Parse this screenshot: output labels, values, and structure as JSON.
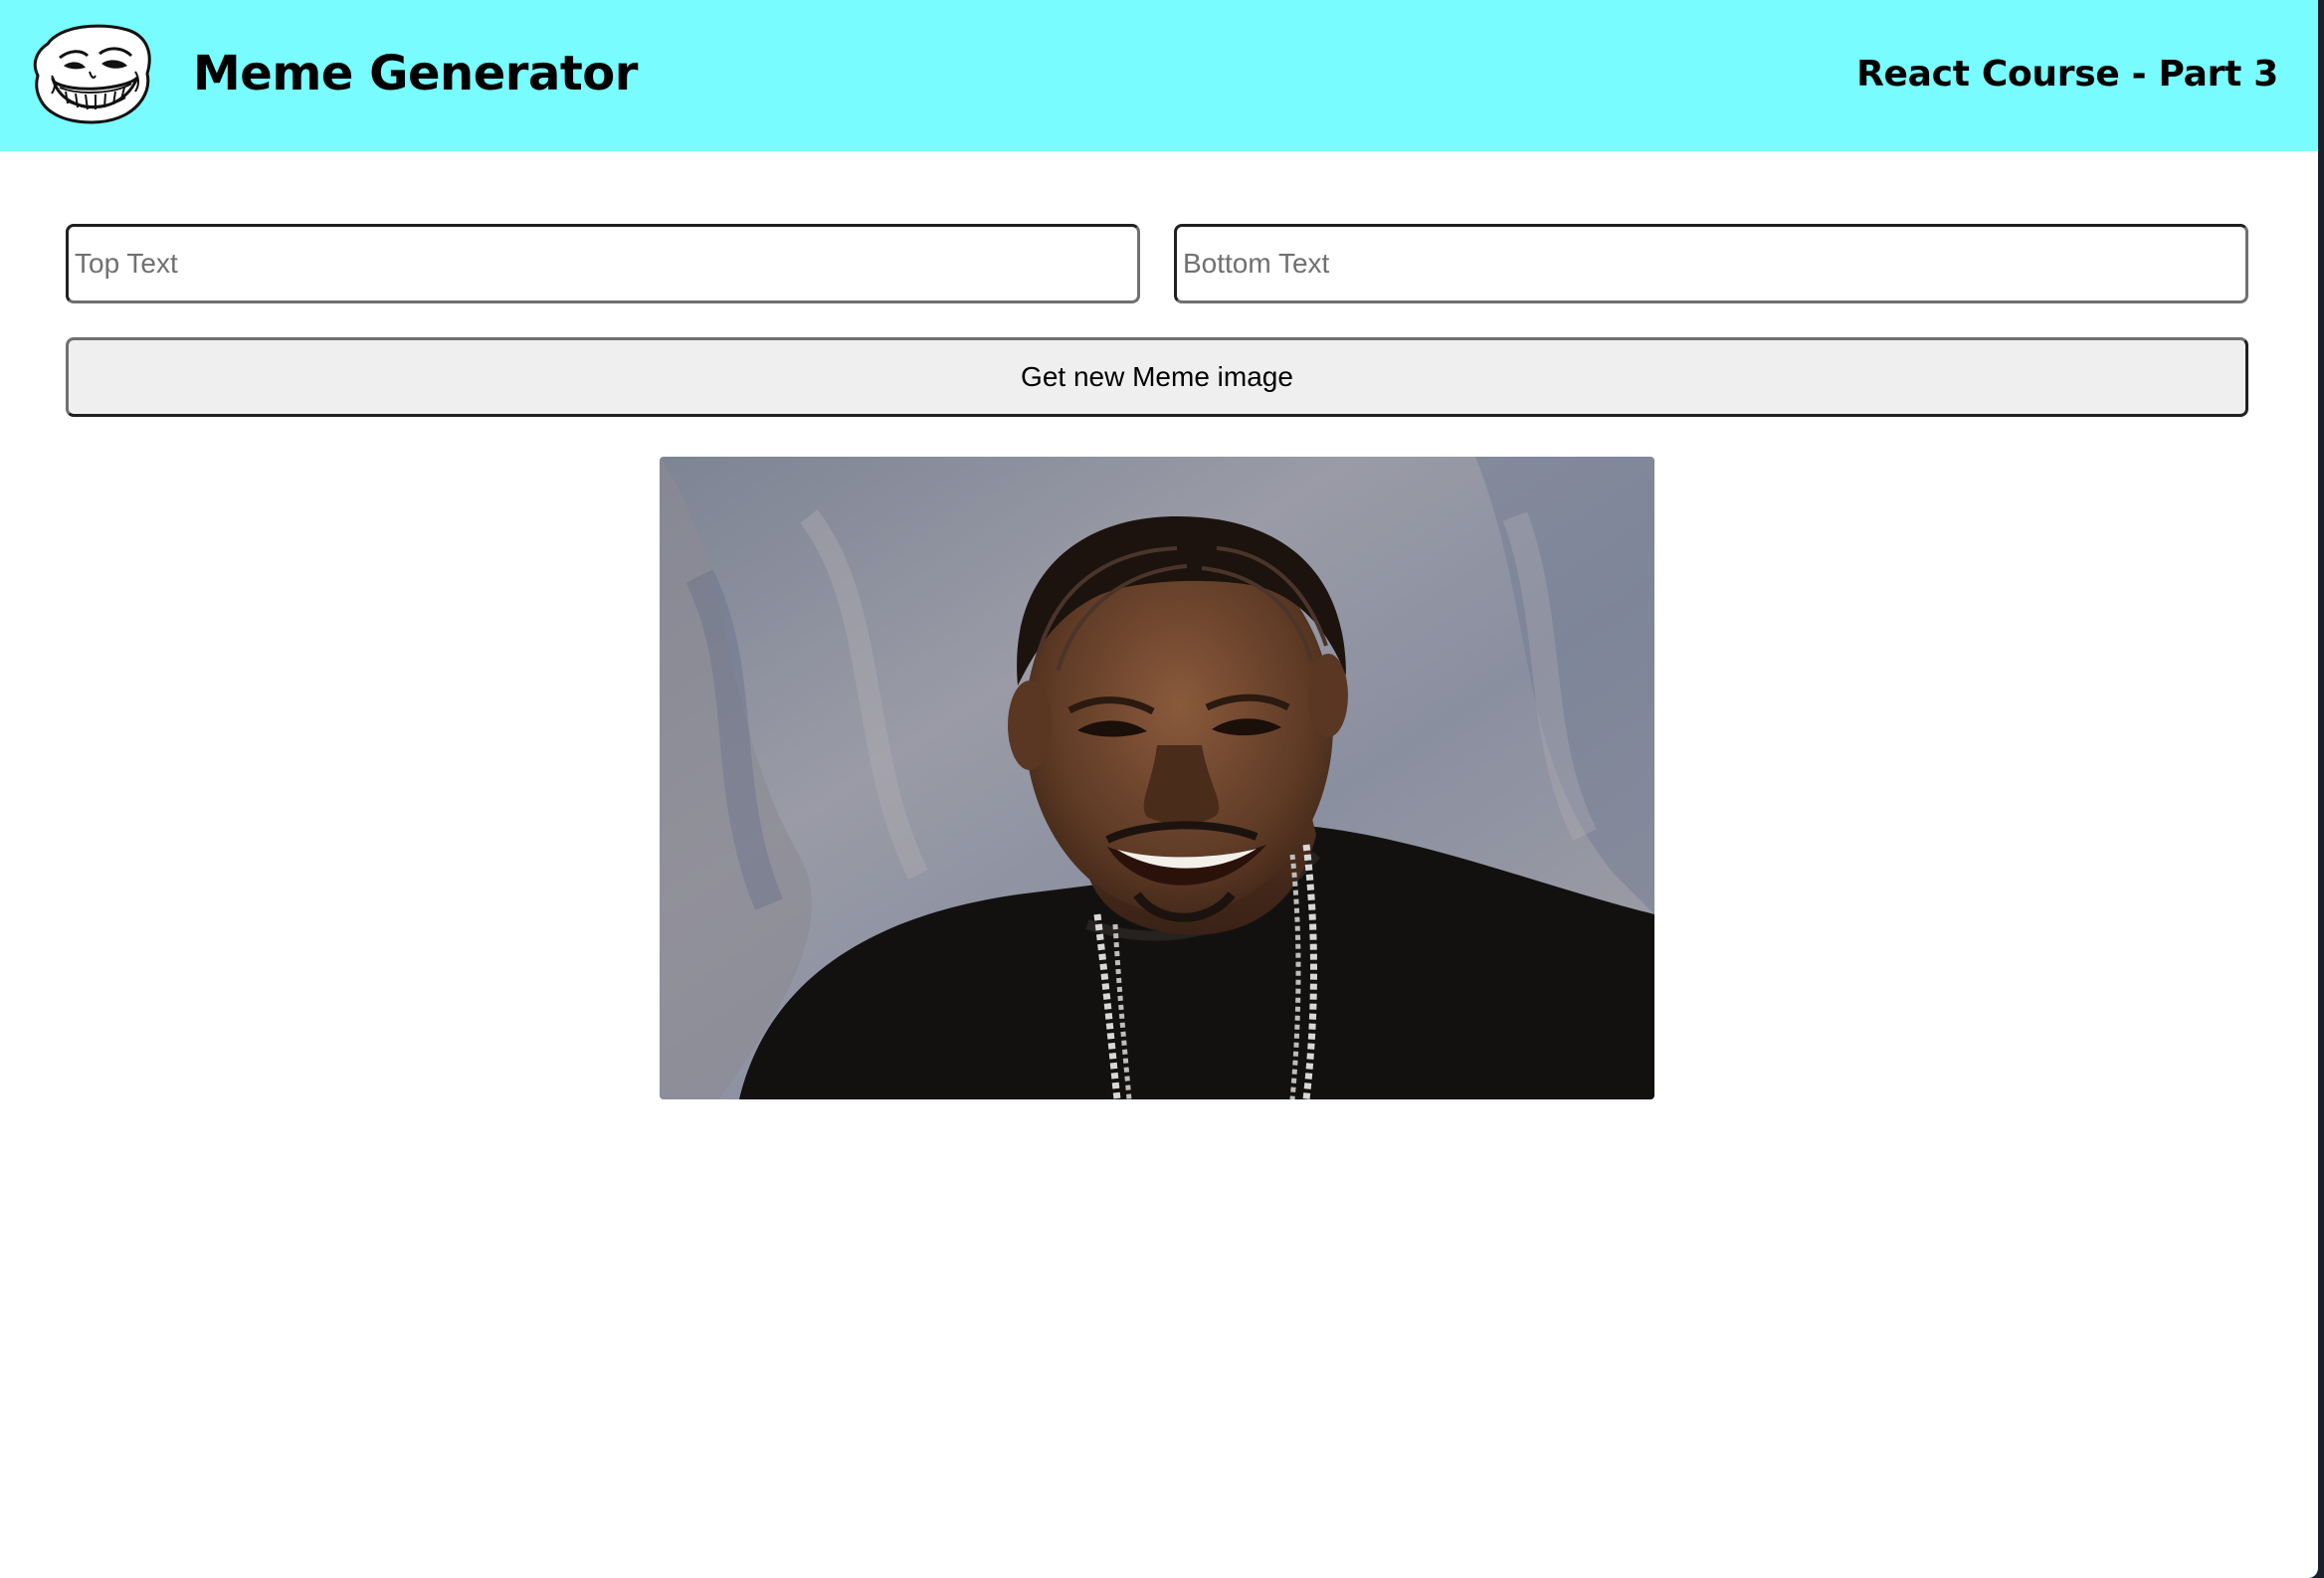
{
  "header": {
    "logo_icon": "troll-face-icon",
    "title": "Meme Generator",
    "course_label": "React Course - Part 3",
    "background_color": "#79fcff"
  },
  "form": {
    "top_text": {
      "value": "",
      "placeholder": "Top Text"
    },
    "bottom_text": {
      "value": "",
      "placeholder": "Bottom Text"
    },
    "get_image_label": "Get new Meme image"
  },
  "meme": {
    "image_subject": "laughing man with cornrow braids, black t-shirt and chain necklace"
  }
}
